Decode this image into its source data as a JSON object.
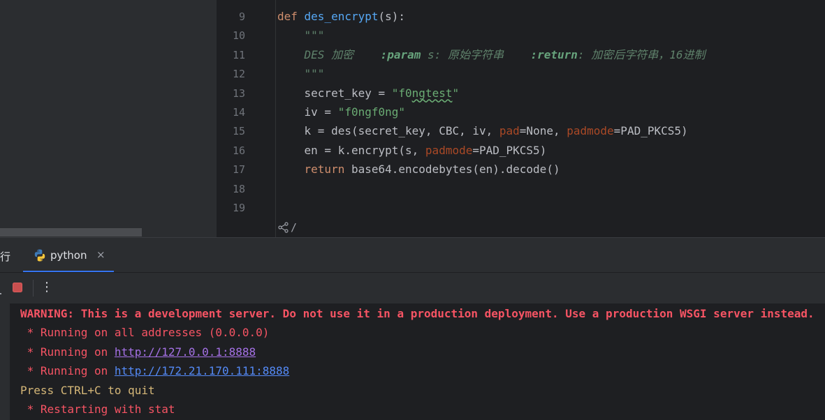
{
  "editor": {
    "lines": [
      {
        "n": "9",
        "code": [
          {
            "t": "def ",
            "c": "kw"
          },
          {
            "t": "des_encrypt",
            "c": "fn"
          },
          {
            "t": "(s):",
            "c": ""
          }
        ]
      },
      {
        "n": "10",
        "code": [
          {
            "t": "    \"\"\"",
            "c": "doc"
          }
        ]
      },
      {
        "n": "11",
        "code": [
          {
            "t": "    DES 加密    ",
            "c": "doc"
          },
          {
            "t": ":param",
            "c": "doctag"
          },
          {
            "t": " s: 原始字符串    ",
            "c": "doc"
          },
          {
            "t": ":return",
            "c": "doctag"
          },
          {
            "t": ": 加密后字符串，16进制",
            "c": "doc"
          }
        ]
      },
      {
        "n": "12",
        "code": [
          {
            "t": "    \"\"\"",
            "c": "doc"
          }
        ]
      },
      {
        "n": "13",
        "code": [
          {
            "t": "    secret_key = ",
            "c": ""
          },
          {
            "t": "\"f0",
            "c": "str"
          },
          {
            "t": "ngtest",
            "c": "str typo"
          },
          {
            "t": "\"",
            "c": "str"
          }
        ]
      },
      {
        "n": "14",
        "code": [
          {
            "t": "    iv = ",
            "c": ""
          },
          {
            "t": "\"f0ngf0ng\"",
            "c": "str"
          }
        ]
      },
      {
        "n": "15",
        "code": [
          {
            "t": "    k = des(secret_key, CBC, iv, ",
            "c": ""
          },
          {
            "t": "pad",
            "c": "param"
          },
          {
            "t": "=None, ",
            "c": ""
          },
          {
            "t": "padmode",
            "c": "param"
          },
          {
            "t": "=PAD_PKCS5)",
            "c": ""
          }
        ]
      },
      {
        "n": "16",
        "code": [
          {
            "t": "    en = k.encrypt(s, ",
            "c": ""
          },
          {
            "t": "padmode",
            "c": "param"
          },
          {
            "t": "=PAD_PKCS5)",
            "c": ""
          }
        ]
      },
      {
        "n": "17",
        "code": [
          {
            "t": "    ",
            "c": ""
          },
          {
            "t": "return",
            "c": "kw"
          },
          {
            "t": " base64.encodebytes(en).decode()",
            "c": ""
          }
        ]
      },
      {
        "n": "18",
        "code": []
      },
      {
        "n": "19",
        "code": []
      }
    ],
    "fold_marker": "/"
  },
  "run_panel": {
    "tab_run_label": "行",
    "tab_python_label": "python",
    "tab_close": "×",
    "more_label": "⋮"
  },
  "console": {
    "warning": "WARNING: This is a development server. Do not use it in a production deployment. Use a production WSGI server instead.",
    "line_all_prefix": " * Running on all addresses (0.0.0.0)",
    "line_local_prefix": " * Running on ",
    "line_local_url": "http://127.0.0.1:8888",
    "line_lan_prefix": " * Running on ",
    "line_lan_url": "http://172.21.170.111:8888",
    "quit_hint": "Press CTRL+C to quit",
    "restart": " * Restarting with stat"
  },
  "colors": {
    "accent": "#3574f0",
    "error_red": "#f75464",
    "hint_yellow": "#d5b778",
    "link_blue": "#548af7",
    "link_visited": "#a571e6"
  }
}
